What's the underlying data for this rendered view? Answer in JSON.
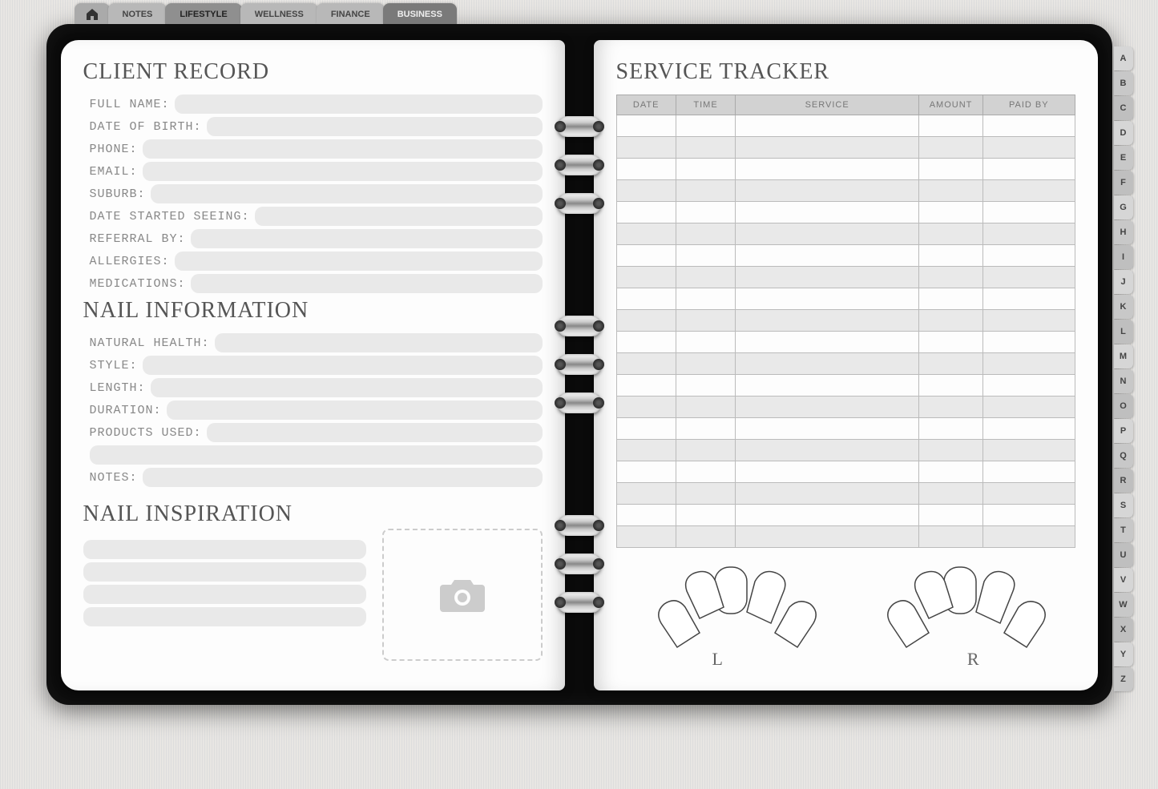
{
  "tabs_top": [
    "NOTES",
    "LIFESTYLE",
    "WELLNESS",
    "FINANCE",
    "BUSINESS"
  ],
  "alpha": [
    "A",
    "B",
    "C",
    "D",
    "E",
    "F",
    "G",
    "H",
    "I",
    "J",
    "K",
    "L",
    "M",
    "N",
    "O",
    "P",
    "Q",
    "R",
    "S",
    "T",
    "U",
    "V",
    "W",
    "X",
    "Y",
    "Z"
  ],
  "left": {
    "section1": "CLIENT RECORD",
    "section2": "NAIL INFORMATION",
    "section3": "NAIL INSPIRATION",
    "fields1": [
      {
        "label": "FULL NAME:",
        "value": ""
      },
      {
        "label": "DATE OF BIRTH:",
        "value": ""
      },
      {
        "label": "PHONE:",
        "value": ""
      },
      {
        "label": "EMAIL:",
        "value": ""
      },
      {
        "label": "SUBURB:",
        "value": ""
      },
      {
        "label": "DATE STARTED SEEING:",
        "value": ""
      },
      {
        "label": "REFERRAL BY:",
        "value": ""
      },
      {
        "label": "ALLERGIES:",
        "value": ""
      },
      {
        "label": "MEDICATIONS:",
        "value": ""
      }
    ],
    "fields2": [
      {
        "label": "NATURAL HEALTH:",
        "value": ""
      },
      {
        "label": "STYLE:",
        "value": ""
      },
      {
        "label": "LENGTH:",
        "value": ""
      },
      {
        "label": "DURATION:",
        "value": ""
      },
      {
        "label": "PRODUCTS USED:",
        "value": ""
      }
    ],
    "notes_label": "NOTES:"
  },
  "right": {
    "section": "SERVICE TRACKER",
    "columns": [
      "DATE",
      "TIME",
      "SERVICE",
      "AMOUNT",
      "PAID BY"
    ],
    "row_count": 20,
    "left_hand": "L",
    "right_hand": "R"
  }
}
